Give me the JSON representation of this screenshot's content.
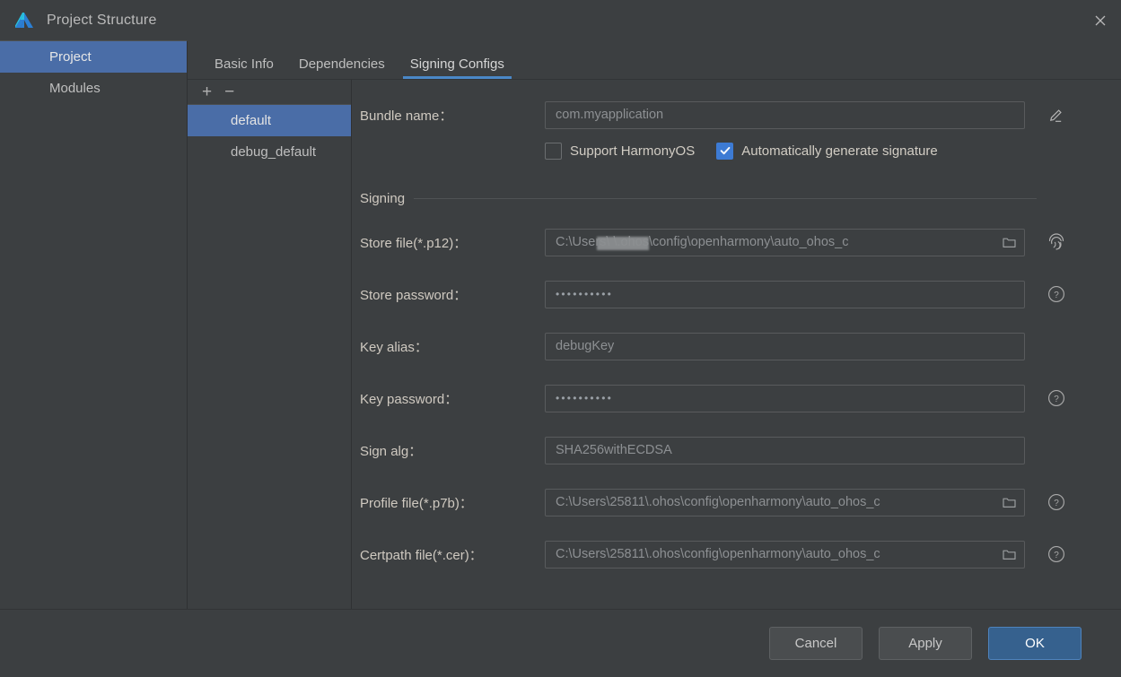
{
  "window": {
    "title": "Project Structure",
    "logo_icon": "deveco-logo-icon",
    "close_icon": "close-icon"
  },
  "sidebar": {
    "items": [
      {
        "label": "Project",
        "selected": true
      },
      {
        "label": "Modules",
        "selected": false
      }
    ]
  },
  "tabs": [
    {
      "label": "Basic Info",
      "active": false
    },
    {
      "label": "Dependencies",
      "active": false
    },
    {
      "label": "Signing Configs",
      "active": true
    }
  ],
  "config_list": {
    "add_label": "+",
    "remove_label": "−",
    "items": [
      {
        "label": "default",
        "selected": true
      },
      {
        "label": "debug_default",
        "selected": false
      }
    ]
  },
  "form": {
    "bundle": {
      "label": "Bundle name：",
      "value": "com.myapplication",
      "edit_icon": "pencil-edit-icon"
    },
    "checkboxes": [
      {
        "label": "Support HarmonyOS",
        "checked": false
      },
      {
        "label": "Automatically generate signature",
        "checked": true
      }
    ],
    "section_title": "Signing",
    "fields": [
      {
        "label": "Store file(*.p12)：",
        "value": "C:\\Users\\              \\.ohos\\config\\openharmony\\auto_ohos_c",
        "redacted": true,
        "has_folder": true,
        "side_icon": "fingerprint-icon"
      },
      {
        "label": "Store password：",
        "value": "••••••••••",
        "masked": true,
        "has_folder": false,
        "side_icon": "help-question-icon"
      },
      {
        "label": "Key alias：",
        "value": "debugKey",
        "has_folder": false,
        "side_icon": null
      },
      {
        "label": "Key password：",
        "value": "••••••••••",
        "masked": true,
        "has_folder": false,
        "side_icon": "help-question-icon"
      },
      {
        "label": "Sign alg：",
        "value": "SHA256withECDSA",
        "has_folder": false,
        "side_icon": null
      },
      {
        "label": "Profile file(*.p7b)：",
        "value": "C:\\Users\\25811\\.ohos\\config\\openharmony\\auto_ohos_c",
        "has_folder": true,
        "side_icon": "help-question-icon"
      },
      {
        "label": "Certpath file(*.cer)：",
        "value": "C:\\Users\\25811\\.ohos\\config\\openharmony\\auto_ohos_c",
        "has_folder": true,
        "side_icon": "help-question-icon"
      }
    ]
  },
  "footer": {
    "cancel_label": "Cancel",
    "apply_label": "Apply",
    "ok_label": "OK"
  },
  "colors": {
    "window_bg": "#3c3f41",
    "selection_blue": "#4a6da7",
    "accent_blue": "#4a88c7",
    "checkbox_blue": "#3d7bd4",
    "primary_button": "#36618e"
  }
}
